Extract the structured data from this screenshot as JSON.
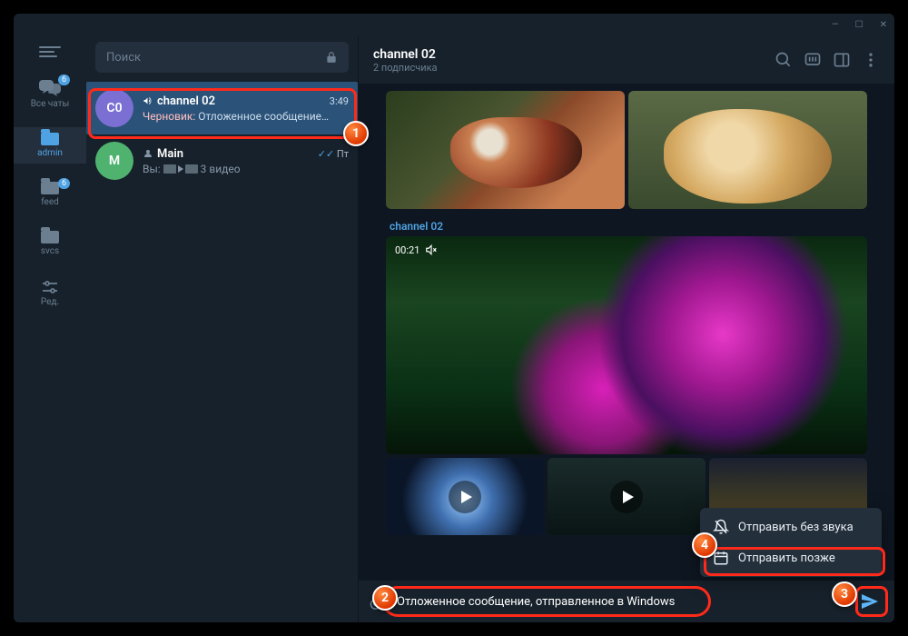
{
  "window": {
    "minimize": "—",
    "maximize": "☐",
    "close": "✕"
  },
  "search": {
    "placeholder": "Поиск"
  },
  "nav": {
    "items": [
      {
        "label": "Все чаты",
        "badge": "6"
      },
      {
        "label": "admin"
      },
      {
        "label": "feed",
        "badge": "6"
      },
      {
        "label": "svcs"
      },
      {
        "label": "Ред."
      }
    ]
  },
  "chats": [
    {
      "avatar": "C0",
      "title": "channel 02",
      "time": "3:49",
      "draft_prefix": "Черновик:",
      "preview": "Отложенное сообщение…"
    },
    {
      "avatar": "M",
      "title": "Main",
      "time": "Пт",
      "you": "Вы:",
      "preview": "3 видео",
      "read": true
    }
  ],
  "header": {
    "title": "channel 02",
    "subtitle": "2 подписчика"
  },
  "video": {
    "duration": "00:21",
    "channel_tag": "channel 02"
  },
  "context_menu": {
    "items": [
      {
        "label": "Отправить без звука"
      },
      {
        "label": "Отправить позже"
      }
    ]
  },
  "composer": {
    "text": "Отложенное сообщение, отправленное в Windows"
  },
  "callouts": {
    "n1": "1",
    "n2": "2",
    "n3": "3",
    "n4": "4"
  }
}
